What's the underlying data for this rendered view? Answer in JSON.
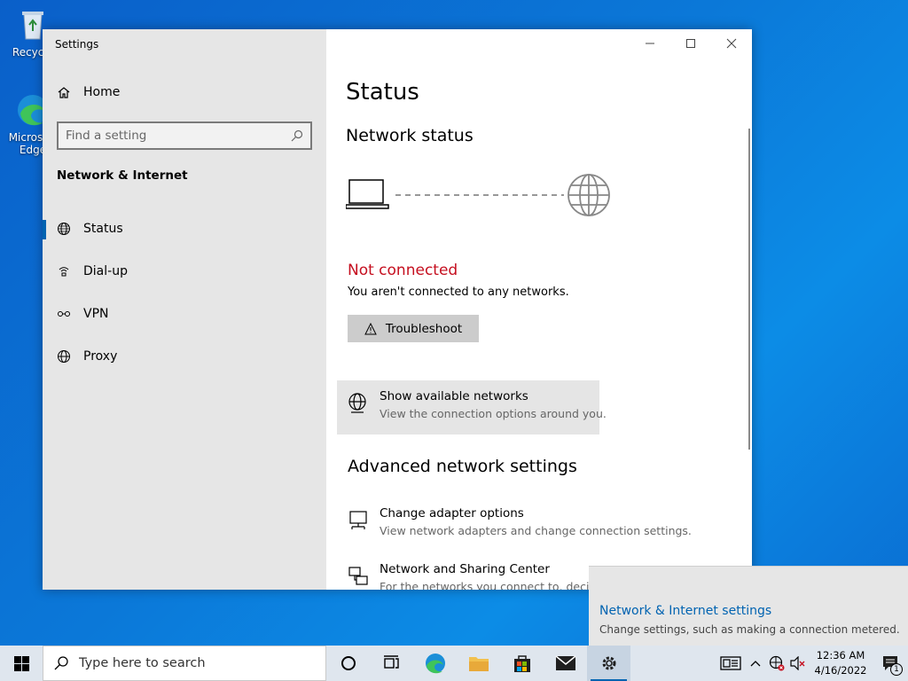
{
  "desktop": {
    "recycle_label": "Recycle",
    "edge_label": "Microsoft Edge"
  },
  "window": {
    "title": "Settings",
    "controls": [
      "minimize",
      "maximize",
      "close"
    ]
  },
  "sidebar": {
    "home_label": "Home",
    "search_placeholder": "Find a setting",
    "section_title": "Network & Internet",
    "items": [
      {
        "label": "Status",
        "icon": "status-globe-icon",
        "active": true
      },
      {
        "label": "Dial-up",
        "icon": "dialup-icon",
        "active": false
      },
      {
        "label": "VPN",
        "icon": "vpn-icon",
        "active": false
      },
      {
        "label": "Proxy",
        "icon": "globe-icon",
        "active": false
      }
    ]
  },
  "main": {
    "title": "Status",
    "network_status_heading": "Network status",
    "connection_state": "Not connected",
    "connection_desc": "You aren't connected to any networks.",
    "troubleshoot_label": "Troubleshoot",
    "show_networks": {
      "title": "Show available networks",
      "desc": "View the connection options around you."
    },
    "advanced_heading": "Advanced network settings",
    "advanced_items": [
      {
        "title": "Change adapter options",
        "desc": "View network adapters and change connection settings."
      },
      {
        "title": "Network and Sharing Center",
        "desc": "For the networks you connect to, decide what"
      }
    ]
  },
  "toast": {
    "title": "Network & Internet settings",
    "desc": "Change settings, such as making a connection metered."
  },
  "taskbar": {
    "search_placeholder": "Type here to search",
    "time": "12:36 AM",
    "date": "4/16/2022",
    "notification_count": "1"
  },
  "colors": {
    "accent": "#0063b1",
    "error": "#c50f1f",
    "sidebar_bg": "#e6e6e6"
  }
}
